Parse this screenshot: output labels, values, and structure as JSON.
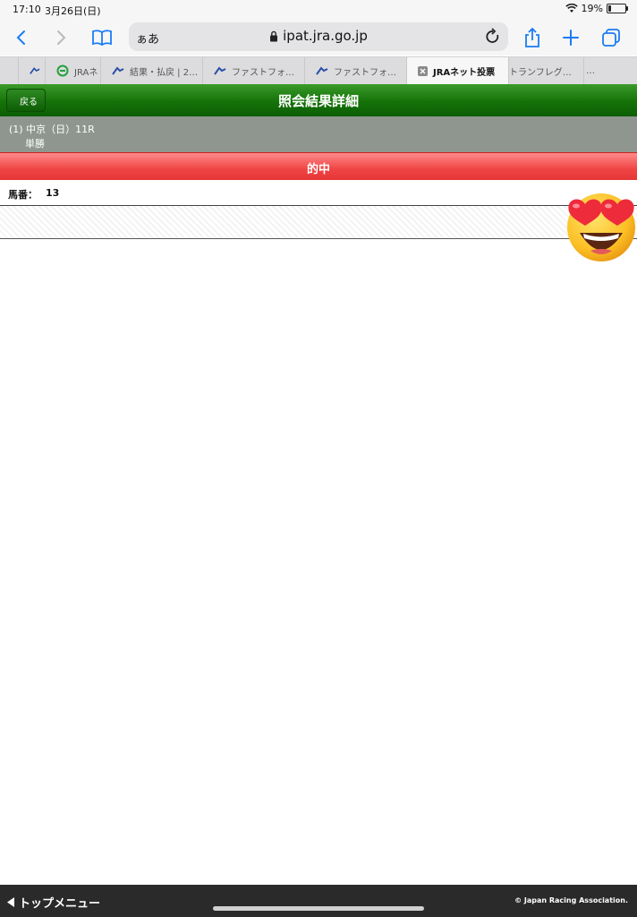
{
  "status": {
    "time": "17:10",
    "date": "3月26日(日)",
    "battery": "19%",
    "battery_level": 0.19
  },
  "toolbar": {
    "text_size": "ぁあ",
    "url": "ipat.jra.go.jp"
  },
  "tabs": [
    {
      "label": ""
    },
    {
      "label": "JRAネ"
    },
    {
      "label": "結果・払戻 | 2…"
    },
    {
      "label": "ファストフォ…"
    },
    {
      "label": "ファストフォ…"
    },
    {
      "label": "JRAネット投票"
    },
    {
      "label": "トランフレグ…"
    },
    {
      "label": "…"
    }
  ],
  "header": {
    "back_label": "戻る",
    "title": "照会結果詳細"
  },
  "race": {
    "line1": "(1) 中京（日）11R",
    "bet_type": "単勝"
  },
  "result": {
    "label": "的中"
  },
  "horse": {
    "label": "馬番：",
    "number": "13"
  },
  "footer": {
    "menu_label": "トップメニュー",
    "copyright": "© Japan Racing Association."
  },
  "colors": {
    "header_green": "#157208",
    "result_red": "#f04444",
    "race_gray": "#8f9690",
    "footer_dark": "#2a2a2a"
  }
}
